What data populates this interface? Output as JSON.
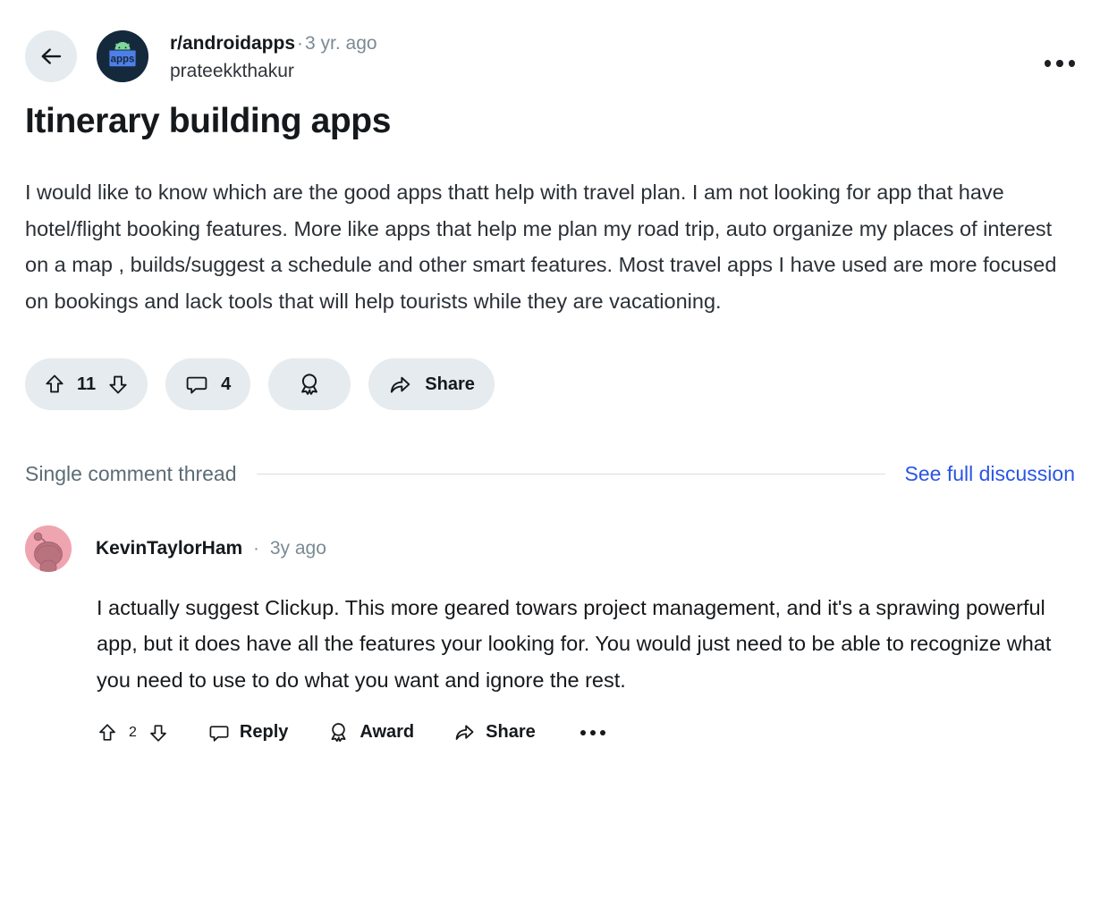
{
  "header": {
    "back_icon": "arrow-left-icon",
    "subreddit_avatar_icon": "androidapps-avatar-icon",
    "subreddit": "r/androidapps",
    "separator": "·",
    "age": "3 yr. ago",
    "author": "prateekkthakur",
    "overflow_icon": "more-horizontal-icon"
  },
  "post": {
    "title": "Itinerary building apps",
    "body": "I would like to know which are the good apps thatt help with travel plan. I am not looking for app that have hotel/flight booking features. More like apps that help me plan my road trip, auto organize my places of interest on a map , builds/suggest a schedule and other smart features. Most travel apps I have used are more focused on bookings and lack tools that will help tourists while they are vacationing."
  },
  "post_actions": {
    "upvote_icon": "upvote-arrow-icon",
    "score": "11",
    "downvote_icon": "downvote-arrow-icon",
    "comment_icon": "comment-bubble-icon",
    "comment_count": "4",
    "award_icon": "award-ribbon-icon",
    "share_icon": "share-arrow-icon",
    "share_label": "Share"
  },
  "thread_bar": {
    "label": "Single comment thread",
    "link": "See full discussion",
    "link_color": "#2a55e5"
  },
  "comment": {
    "avatar_icon": "snoo-avatar-icon",
    "username": "KevinTaylorHam",
    "separator": "·",
    "age": "3y ago",
    "body": "I actually suggest Clickup. This more geared towars project management, and it's a sprawing powerful app, but it does have all the features your looking for. You would just need to be able to recognize what you need to use to do what you want and ignore the rest.",
    "actions": {
      "upvote_icon": "upvote-arrow-icon",
      "score": "2",
      "downvote_icon": "downvote-arrow-icon",
      "reply_icon": "comment-bubble-icon",
      "reply_label": "Reply",
      "award_icon": "award-ribbon-icon",
      "award_label": "Award",
      "share_icon": "share-arrow-icon",
      "share_label": "Share",
      "overflow_icon": "more-horizontal-icon"
    }
  },
  "theme": {
    "pill_background": "#e5ebee",
    "text_primary": "#16191c",
    "text_muted": "#7b8a94",
    "link": "#2a55e5",
    "avatar_pink": "#efa5af",
    "avatar_navy": "#15293d"
  }
}
